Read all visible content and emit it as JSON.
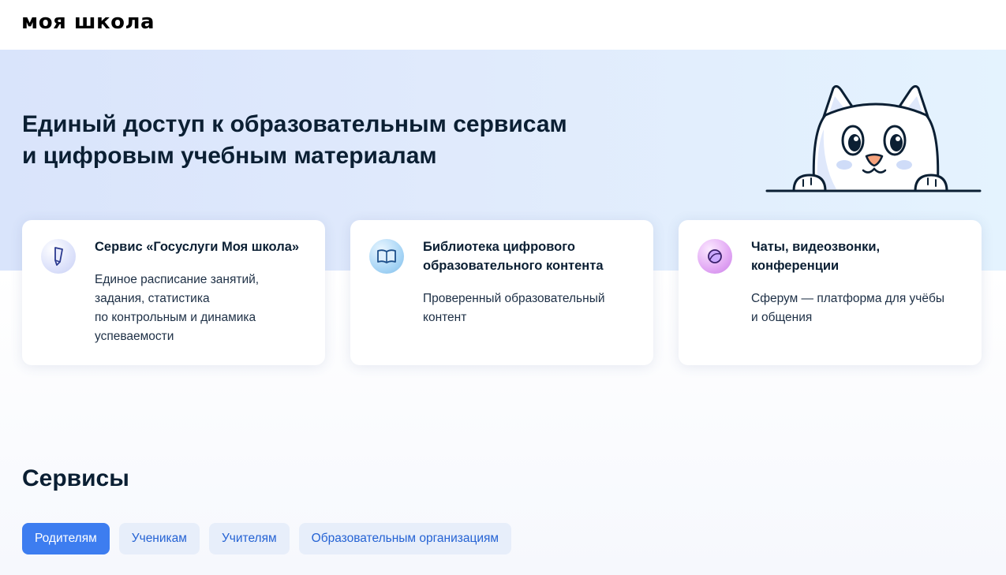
{
  "header": {
    "logo": "моя школа"
  },
  "hero": {
    "title_lines": [
      "Единый доступ к образовательным сервисам",
      "и цифровым учебным материалам"
    ]
  },
  "cards": [
    {
      "icon": "pencil-icon",
      "title_lines": [
        "Сервис «Госуслуги Моя школа»"
      ],
      "text_lines": [
        "Единое расписание занятий,",
        "задания, статистика",
        "по контрольным и динамика",
        "успеваемости"
      ]
    },
    {
      "icon": "book-icon",
      "title_lines": [
        "Библиотека цифрового",
        "образовательного контента"
      ],
      "text_lines": [
        "Проверенный образовательный",
        "контент"
      ]
    },
    {
      "icon": "sphere-icon",
      "title_lines": [
        "Чаты, видеозвонки,",
        "конференции"
      ],
      "text_lines": [
        "Сферум — платформа для учёбы",
        "и общения"
      ]
    }
  ],
  "services": {
    "title": "Сервисы",
    "tabs": [
      {
        "label": "Родителям",
        "active": true
      },
      {
        "label": "Ученикам",
        "active": false
      },
      {
        "label": "Учителям",
        "active": false
      },
      {
        "label": "Образовательным организациям",
        "active": false
      }
    ]
  },
  "colors": {
    "accent": "#3d7df0",
    "tab_bg": "#e7eefa",
    "tab_text": "#2563d4",
    "text_dark": "#0b1f33"
  }
}
